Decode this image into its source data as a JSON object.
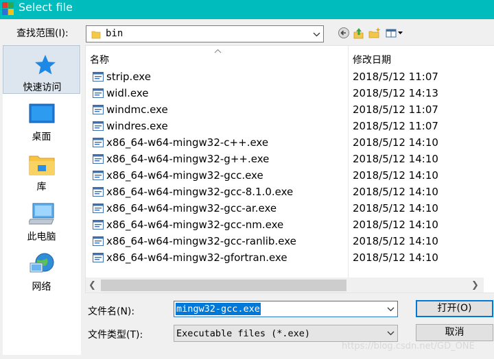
{
  "window": {
    "title": "Select file"
  },
  "toolbar": {
    "look_in_label": "查找范围(I):",
    "look_in_value": "bin",
    "back_icon": "back-arrow-icon",
    "up_icon": "up-folder-icon",
    "new_folder_icon": "new-folder-icon",
    "view_menu_icon": "view-menu-icon"
  },
  "places": [
    {
      "label": "快速访问",
      "icon": "quick-access-star-icon"
    },
    {
      "label": "桌面",
      "icon": "desktop-icon"
    },
    {
      "label": "库",
      "icon": "library-icon"
    },
    {
      "label": "此电脑",
      "icon": "computer-icon"
    },
    {
      "label": "网络",
      "icon": "network-icon"
    }
  ],
  "file_list": {
    "columns": {
      "name": "名称",
      "date": "修改日期"
    },
    "rows": [
      {
        "name": "strip.exe",
        "date": "2018/5/12 11:07"
      },
      {
        "name": "widl.exe",
        "date": "2018/5/12 14:13"
      },
      {
        "name": "windmc.exe",
        "date": "2018/5/12 11:07"
      },
      {
        "name": "windres.exe",
        "date": "2018/5/12 11:07"
      },
      {
        "name": "x86_64-w64-mingw32-c++.exe",
        "date": "2018/5/12 14:10"
      },
      {
        "name": "x86_64-w64-mingw32-g++.exe",
        "date": "2018/5/12 14:10"
      },
      {
        "name": "x86_64-w64-mingw32-gcc.exe",
        "date": "2018/5/12 14:10"
      },
      {
        "name": "x86_64-w64-mingw32-gcc-8.1.0.exe",
        "date": "2018/5/12 14:10"
      },
      {
        "name": "x86_64-w64-mingw32-gcc-ar.exe",
        "date": "2018/5/12 14:10"
      },
      {
        "name": "x86_64-w64-mingw32-gcc-nm.exe",
        "date": "2018/5/12 14:10"
      },
      {
        "name": "x86_64-w64-mingw32-gcc-ranlib.exe",
        "date": "2018/5/12 14:10"
      },
      {
        "name": "x86_64-w64-mingw32-gfortran.exe",
        "date": "2018/5/12 14:10"
      }
    ]
  },
  "bottom": {
    "filename_label": "文件名(N):",
    "filename_value": "mingw32-gcc.exe",
    "filetype_label": "文件类型(T):",
    "filetype_value": "Executable files (*.exe)",
    "open_label": "打开(O)",
    "cancel_label": "取消"
  },
  "watermark": "https://blog.csdn.net/GD_ONE",
  "colors": {
    "title_bar": "#00bcbc",
    "selection": "#0078d7",
    "quick_access_bg": "#dde5ee"
  }
}
